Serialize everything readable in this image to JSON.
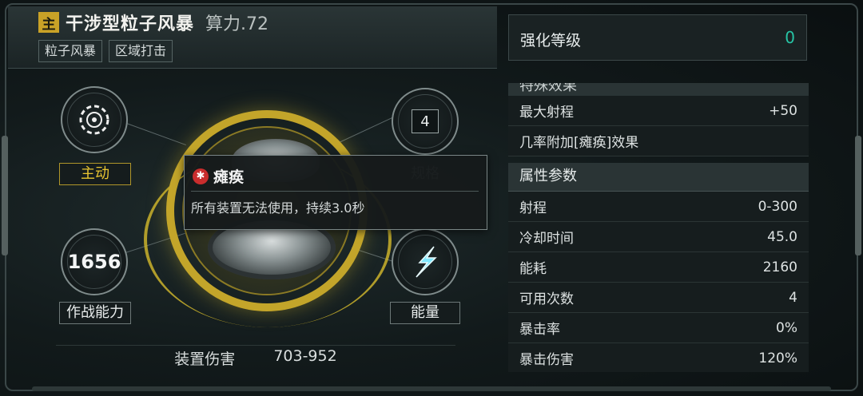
{
  "header": {
    "badge": "主",
    "title": "干涉型粒子风暴",
    "power": "算力.72",
    "tags": [
      "粒子风暴",
      "区域打击"
    ]
  },
  "nodes": {
    "mode_label": "主动",
    "combat_value": "1656",
    "combat_label": "作战能力",
    "spec_value": "4",
    "spec_label": "规格",
    "energy_label": "能量"
  },
  "damage": {
    "label": "装置伤害",
    "value": "703-952"
  },
  "tooltip": {
    "title": "瘫痪",
    "description": "所有装置无法使用，持续3.0秒"
  },
  "level": {
    "label": "强化等级",
    "value": "0"
  },
  "special": {
    "header": "特殊效果",
    "rows": [
      {
        "label": "最大射程",
        "value": "+50"
      },
      {
        "label": "几率附加[瘫痪]效果",
        "value": ""
      }
    ]
  },
  "attributes": {
    "header": "属性参数",
    "rows": [
      {
        "label": "射程",
        "value": "0-300"
      },
      {
        "label": "冷却时间",
        "value": "45.0"
      },
      {
        "label": "能耗",
        "value": "2160"
      },
      {
        "label": "可用次数",
        "value": "4"
      },
      {
        "label": "暴击率",
        "value": "0%"
      },
      {
        "label": "暴击伤害",
        "value": "120%"
      }
    ]
  },
  "colors": {
    "gold": "#c9a227",
    "teal": "#27c4a5",
    "paralysis_red": "#c92d2d"
  }
}
